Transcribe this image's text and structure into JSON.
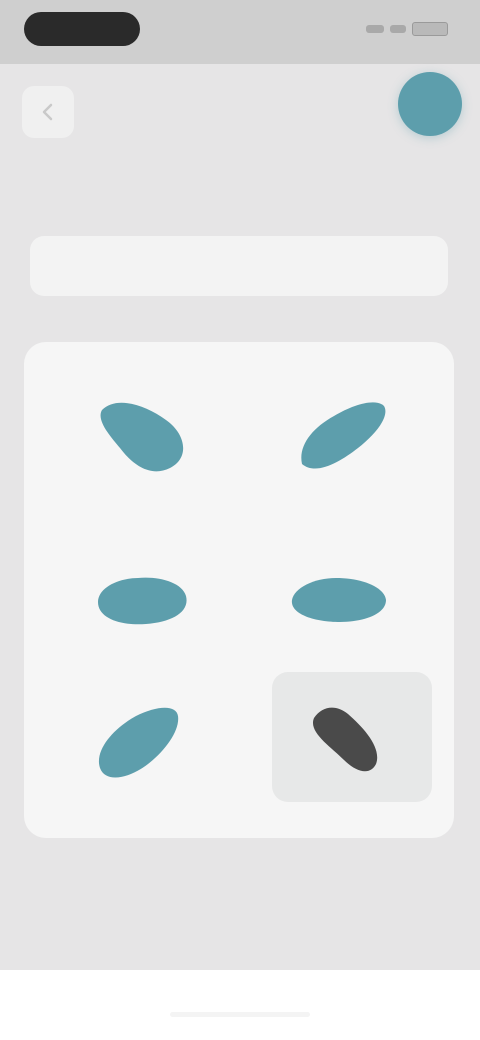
{
  "status_bar": {
    "time": "",
    "colors": {
      "background": "#cfcfcf",
      "pill": "#2a2a2a"
    }
  },
  "header": {
    "back_icon": "arrow-left-icon",
    "avatar_color": "#5d9eac",
    "title": "",
    "subtitle": ""
  },
  "filter": {
    "label": "",
    "action": "",
    "action_color": "#6fb0bb"
  },
  "grid": {
    "section_label": "",
    "accent_color": "#5d9eac",
    "selected_color": "#4a4a4a",
    "items": [
      {
        "icon": "leaf-shape-icon",
        "selected": false
      },
      {
        "icon": "feather-shape-icon",
        "selected": false
      },
      {
        "icon": "cloud-shape-icon",
        "selected": false
      },
      {
        "icon": "cloud-shape-icon",
        "selected": false
      },
      {
        "icon": "leaf-shape-icon",
        "selected": false
      },
      {
        "icon": "brush-shape-icon",
        "selected": true
      }
    ]
  },
  "footnote": ""
}
